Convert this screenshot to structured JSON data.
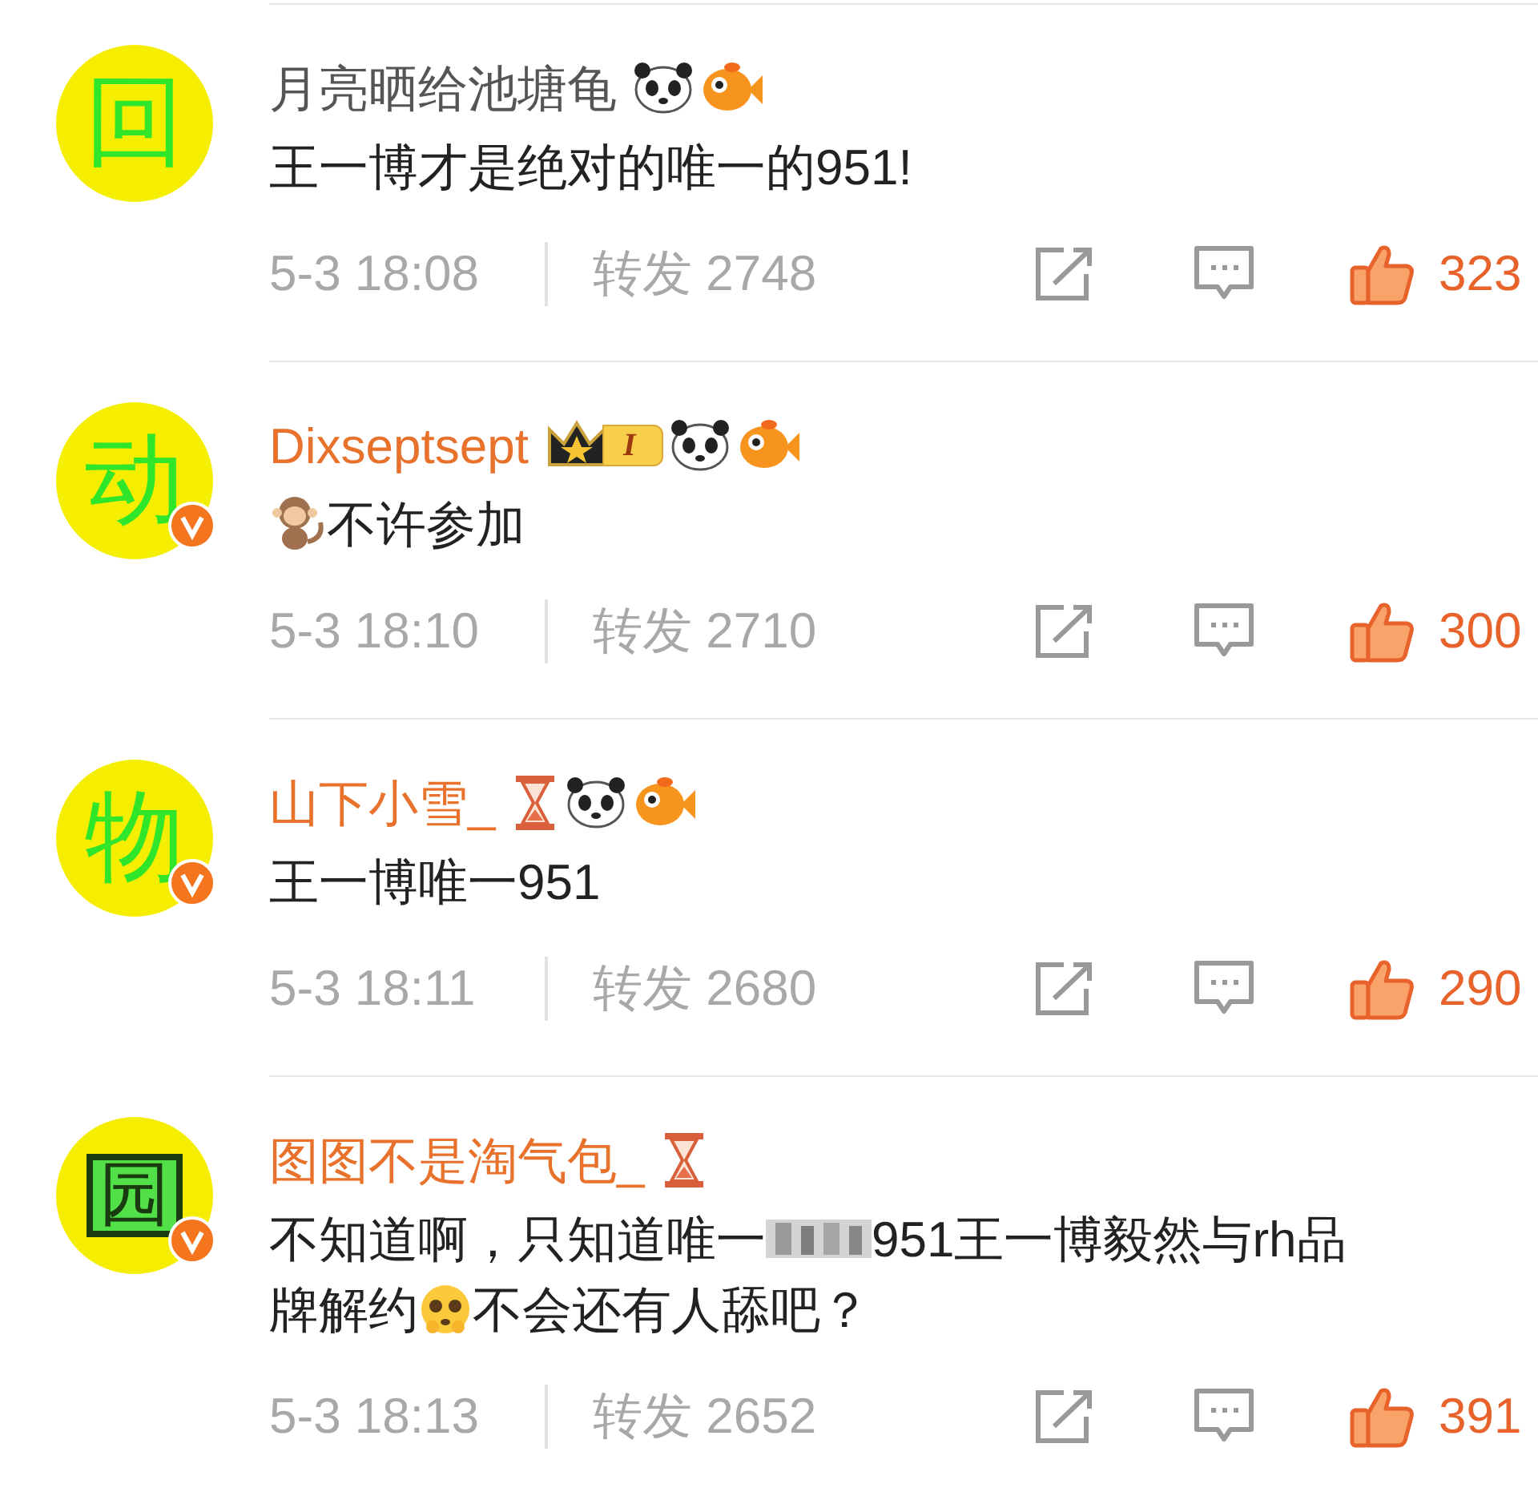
{
  "comments": [
    {
      "avatar": {
        "char": "回",
        "kind": "plain",
        "verified": false
      },
      "name": "月亮晒给池塘龟",
      "vip": false,
      "badges": [
        {
          "kind": "panda"
        },
        {
          "kind": "fish"
        }
      ],
      "content": [
        {
          "kind": "text",
          "text": "王一博才是绝对的唯一的951!"
        }
      ],
      "time": "5-3 18:08",
      "repost_label": "转发",
      "repost_count": "2748",
      "likes": "323"
    },
    {
      "avatar": {
        "char": "动",
        "kind": "plain",
        "verified": true
      },
      "name": "Dixseptsept",
      "vip": true,
      "badges": [
        {
          "kind": "crown",
          "label": "I"
        },
        {
          "kind": "panda"
        },
        {
          "kind": "fish"
        }
      ],
      "content": [
        {
          "kind": "monkey"
        },
        {
          "kind": "text",
          "text": "不许参加"
        }
      ],
      "time": "5-3 18:10",
      "repost_label": "转发",
      "repost_count": "2710",
      "likes": "300"
    },
    {
      "avatar": {
        "char": "物",
        "kind": "plain",
        "verified": true
      },
      "name": "山下小雪_",
      "vip": true,
      "badges": [
        {
          "kind": "hourglass"
        },
        {
          "kind": "panda"
        },
        {
          "kind": "fish"
        }
      ],
      "content": [
        {
          "kind": "text",
          "text": "王一博唯一951"
        }
      ],
      "time": "5-3 18:11",
      "repost_label": "转发",
      "repost_count": "2680",
      "likes": "290"
    },
    {
      "avatar": {
        "char": "园",
        "kind": "framed",
        "verified": true
      },
      "name": "图图不是淘气包_",
      "vip": true,
      "badges": [
        {
          "kind": "hourglass"
        }
      ],
      "content": [
        {
          "kind": "text",
          "text": "不知道啊，只知道唯一"
        },
        {
          "kind": "blur"
        },
        {
          "kind": "text",
          "text": "951王一博毅然与rh品"
        },
        {
          "kind": "text",
          "text": "牌解约"
        },
        {
          "kind": "pleading"
        },
        {
          "kind": "text",
          "text": "不会还有人舔吧？"
        }
      ],
      "time": "5-3 18:13",
      "repost_label": "转发",
      "repost_count": "2652",
      "likes": "391"
    }
  ]
}
